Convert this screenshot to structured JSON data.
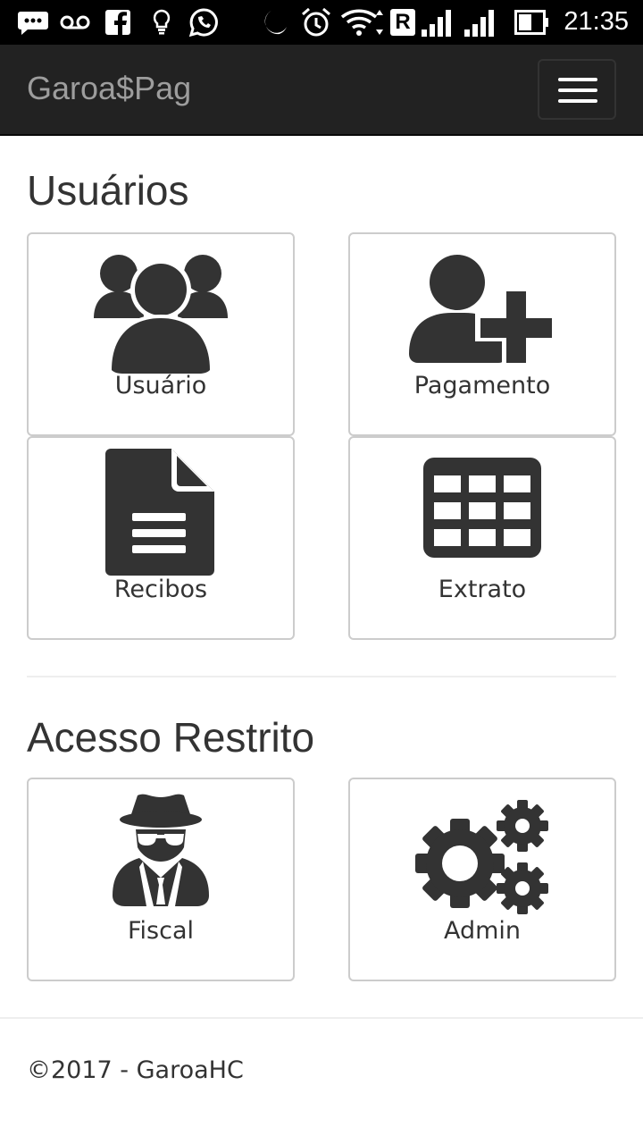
{
  "statusbar": {
    "time": "21:35",
    "icons": [
      "chat-icon",
      "voicemail-icon",
      "facebook-icon",
      "lightbulb-icon",
      "whatsapp-icon",
      "moon-icon",
      "alarm-icon",
      "wifi-icon",
      "roaming-icon",
      "signal-icon",
      "signal-icon",
      "battery-icon"
    ],
    "roaming_letter": "R"
  },
  "navbar": {
    "brand": "Garoa$Pag",
    "menu_icon": "hamburger-icon"
  },
  "sections": {
    "users": {
      "title": "Usuários",
      "tiles": [
        {
          "label": "Usuário",
          "icon": "users-icon"
        },
        {
          "label": "Pagamento",
          "icon": "user-plus-icon"
        },
        {
          "label": "Recibos",
          "icon": "document-icon"
        },
        {
          "label": "Extrato",
          "icon": "table-icon"
        }
      ]
    },
    "restricted": {
      "title": "Acesso Restrito",
      "tiles": [
        {
          "label": "Fiscal",
          "icon": "spy-icon"
        },
        {
          "label": "Admin",
          "icon": "gears-icon"
        }
      ]
    }
  },
  "footer": {
    "text": "©2017 - GaroaHC"
  },
  "colors": {
    "navbar_bg": "#222222",
    "brand": "#9d9d9d",
    "icon": "#333333",
    "tile_border": "#cccccc"
  }
}
